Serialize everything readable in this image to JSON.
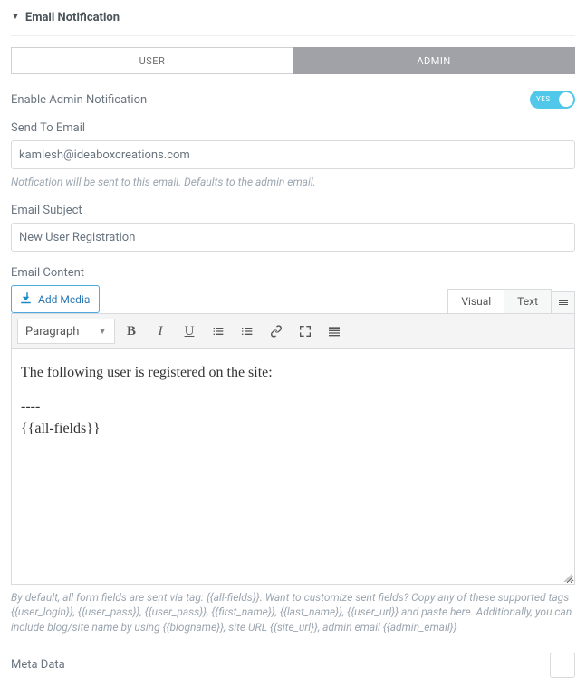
{
  "panel": {
    "title": "Email Notification"
  },
  "tabs": {
    "user": "USER",
    "admin": "ADMIN"
  },
  "fields": {
    "enable_label": "Enable Admin Notification",
    "toggle_text": "YES",
    "send_to_label": "Send To Email",
    "send_to_value": "kamlesh@ideaboxcreations.com",
    "send_to_help": "Notfication will be sent to this email. Defaults to the admin email.",
    "subject_label": "Email Subject",
    "subject_value": "New User Registration",
    "content_label": "Email Content"
  },
  "editor": {
    "add_media": "Add Media",
    "visual_tab": "Visual",
    "text_tab": "Text",
    "format": "Paragraph",
    "body_line1": "The following user is registered on the site:",
    "body_line2": "----",
    "body_line3": "{{all-fields}}",
    "help": "By default, all form fields are sent via tag: {{all-fields}}. Want to customize sent fields? Copy any of these supported tags {{user_login}}, {{user_pass}}, {{user_pass}}, {{first_name}}, {{last_name}}, {{user_url}} and paste here. Additionally, you can include blog/site name by using {{blogname}}, site URL {{site_url}}, admin email {{admin_email}}"
  },
  "meta": {
    "label": "Meta Data"
  }
}
